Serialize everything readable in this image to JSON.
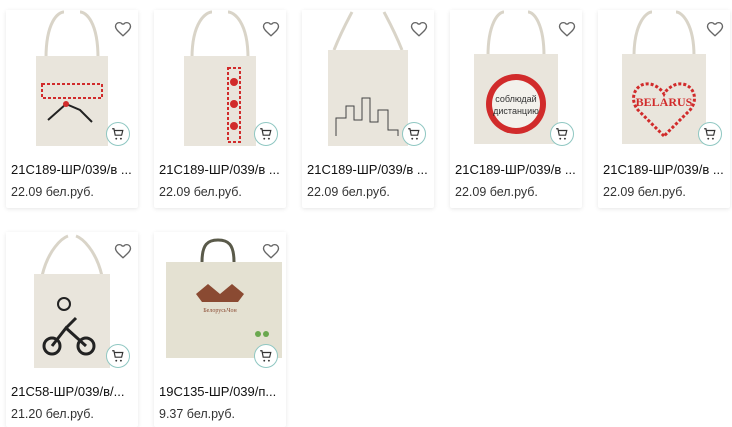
{
  "products": [
    {
      "title": "21С189-ШР/039/в ...",
      "price": "22.09 бел.руб.",
      "icons": [
        "heart-icon",
        "cart-icon"
      ]
    },
    {
      "title": "21С189-ШР/039/в ...",
      "price": "22.09 бел.руб.",
      "icons": [
        "heart-icon",
        "cart-icon"
      ]
    },
    {
      "title": "21С189-ШР/039/в ...",
      "price": "22.09 бел.руб.",
      "icons": [
        "heart-icon",
        "cart-icon"
      ]
    },
    {
      "title": "21С189-ШР/039/в ...",
      "price": "22.09 бел.руб.",
      "sign_text": [
        "соблюдай",
        "дистанцию"
      ],
      "icons": [
        "heart-icon",
        "cart-icon"
      ]
    },
    {
      "title": "21С189-ШР/039/в ...",
      "price": "22.09 бел.руб.",
      "print_text": "BELARUS",
      "icons": [
        "heart-icon",
        "cart-icon"
      ]
    },
    {
      "title": "21С58-ШР/039/в/...",
      "price": "21.20 бел.руб.",
      "icons": [
        "heart-icon",
        "cart-icon"
      ]
    },
    {
      "title": "19С135-ШР/039/п...",
      "price": "9.37 бел.руб.",
      "logo_text": "БелорусьЧон",
      "icons": [
        "heart-icon",
        "cart-icon"
      ]
    }
  ],
  "colors": {
    "accent": "#8fc7c2",
    "bag": "#e9e5dc",
    "print_red": "#d12b2b"
  }
}
